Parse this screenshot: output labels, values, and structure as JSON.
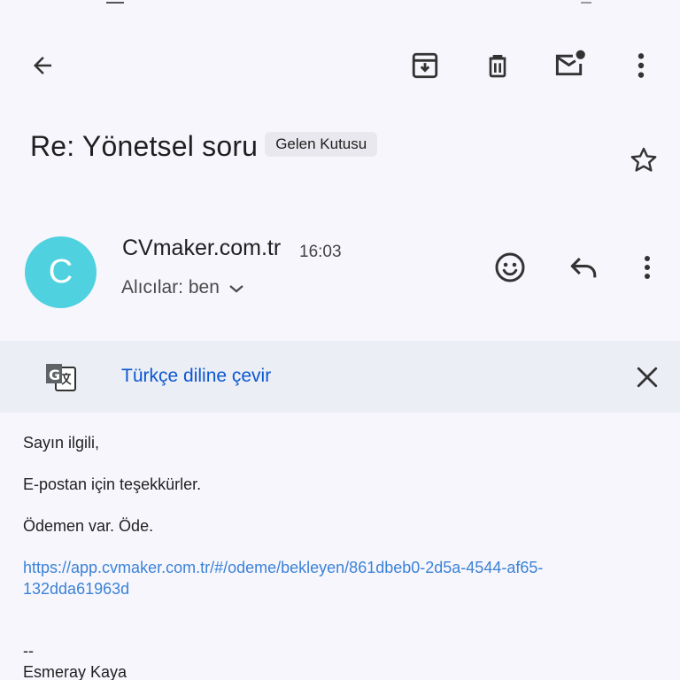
{
  "toolbar": {
    "back_icon": "arrow-left-icon",
    "archive_icon": "archive-icon",
    "delete_icon": "trash-icon",
    "mark_unread_icon": "mail-unread-icon",
    "more_icon": "more-vertical-icon"
  },
  "email": {
    "subject": "Re: Yönetsel soru",
    "label": "Gelen Kutusu",
    "star_icon": "star-outline-icon",
    "sender": {
      "avatar_letter": "C",
      "avatar_color": "#4fd1e0",
      "name": "CVmaker.com.tr",
      "time": "16:03",
      "recipients": "Alıcılar: ben"
    }
  },
  "translate": {
    "link_text": "Türkçe diline çevir",
    "link_color": "#0b57d0"
  },
  "body": {
    "greeting": "Sayın ilgili,",
    "line1": "E-postan için teşekkürler.",
    "line2": "Ödemen var. Öde.",
    "link_line1": "https://app.cvmaker.com.tr/#/odeme/bekleyen/861dbeb0-2d5a-4544-af65-",
    "link_line2": "132dda61963d",
    "link_color": "#3b82d6",
    "signature_sep": "--",
    "signature_name": "Esmeray Kaya"
  }
}
